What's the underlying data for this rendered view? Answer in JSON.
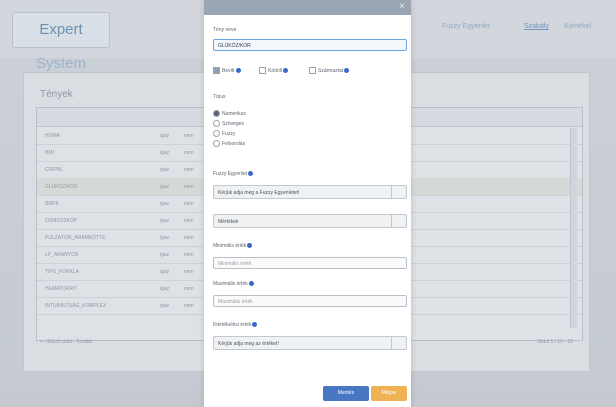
{
  "app": {
    "logo_main": "Expert",
    "logo_sub": "System"
  },
  "nav": {
    "items": [
      "Fuzzy Egyenlet",
      "Szabály",
      "Kiértékel"
    ],
    "active": 1
  },
  "panel": {
    "title": "Tények"
  },
  "table": {
    "rows": [
      [
        "HOMA",
        "igaz",
        "nem",
        "="
      ],
      [
        "BMI",
        "igaz",
        "nem",
        "="
      ],
      [
        "CRP/BL",
        "igaz",
        "nem",
        "="
      ],
      [
        "GLÜKÓZ/KOR",
        "igaz",
        "nem",
        "="
      ],
      [
        "BMFK",
        "igaz",
        "nem",
        "="
      ],
      [
        "OSMOSZKÓP",
        "igaz",
        "nem",
        "="
      ],
      [
        "PULZÁTOR_ÁRAMKÖTTE",
        "igaz",
        "nem",
        "="
      ],
      [
        "LP_ARANYOS",
        "igaz",
        "nem",
        "="
      ],
      [
        "TIPS_FORKLA",
        "igaz",
        "nem",
        "="
      ],
      [
        "HEMATOKRIT",
        "igaz",
        "nem",
        "="
      ],
      [
        "INTUBÁLTSÁG_KOMPLEX",
        "igaz",
        "nem",
        "="
      ]
    ],
    "selected_index": 3
  },
  "pager": {
    "left": "« ‹ Előző oldal › Tovább",
    "right": "Oldal 1 / 10 · 10"
  },
  "modal": {
    "name_label": "Tény neve",
    "name_value": "GLÜKÓZ/KOR",
    "checks": [
      {
        "label": "Bevitt",
        "checked": true
      },
      {
        "label": "Kódolt",
        "checked": false
      },
      {
        "label": "Származtat",
        "checked": false
      }
    ],
    "type_label": "Típus",
    "types": [
      {
        "label": "Numerikus",
        "checked": true
      },
      {
        "label": "Szöveges",
        "checked": false
      },
      {
        "label": "Fuzzy",
        "checked": false
      },
      {
        "label": "Felsorolás",
        "checked": false
      }
    ],
    "fuzzy_label": "Fuzzy Egyenlet",
    "fuzzy_select": "Kérjük adja meg a Fuzzy Egyenletet!",
    "unit_select": "Mértékek",
    "min_label": "Minimális érték",
    "min_placeholder": "Minimális érték",
    "max_label": "Maximális érték",
    "max_placeholder": "Maximális érték",
    "eval_label": "Kiértékelési érték",
    "eval_select": "Kérjük adja meg az értéket!",
    "btn_primary": "Mentés",
    "btn_secondary": "Mégse"
  },
  "colors": {
    "primary": "#4a77c4",
    "secondary": "#eeb255",
    "info": "#3a67c9"
  }
}
